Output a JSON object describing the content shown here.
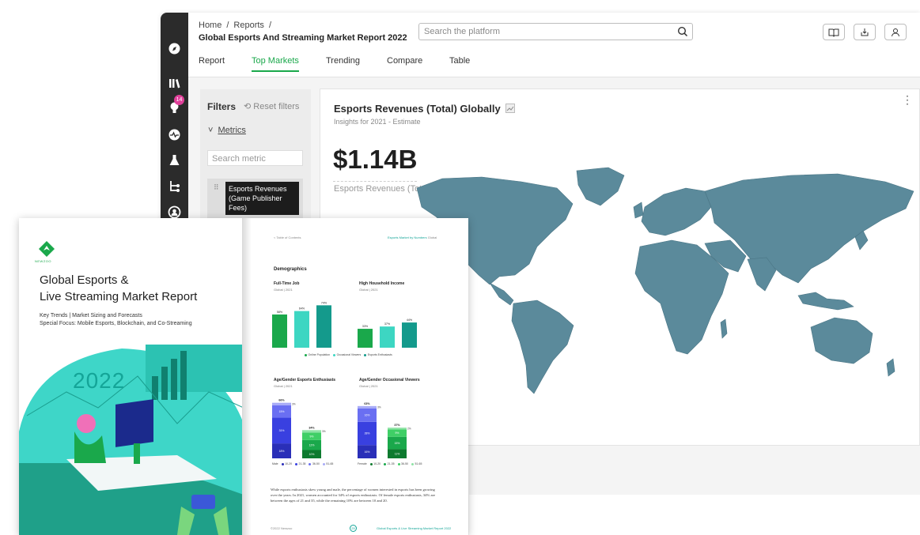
{
  "header": {
    "breadcrumb": [
      "Home",
      "/",
      "Reports",
      "/"
    ],
    "report_title": "Global Esports And Streaming Market Report 2022",
    "search_placeholder": "Search the platform"
  },
  "sidebar": {
    "badge_count": "14"
  },
  "tabs": [
    "Report",
    "Top Markets",
    "Trending",
    "Compare",
    "Table"
  ],
  "active_tab": "Top Markets",
  "filters": {
    "title": "Filters",
    "reset_label": "Reset filters",
    "metrics_label": "Metrics",
    "metric_search_placeholder": "Search metric",
    "selected_metric": "Esports Revenues (Game Publisher Fees)"
  },
  "card": {
    "title": "Esports Revenues (Total) Globally",
    "subtitle": "Insights for 2021 - Estimate",
    "value": "$1.14B",
    "value_label": "Esports Revenues (Total)",
    "map_color": "#5b8a9b"
  },
  "booklet": {
    "cover": {
      "brand": "NEWZOO",
      "title_line1": "Global Esports &",
      "title_line2": "Live Streaming Market Report",
      "sub_line1": "Key Trends | Market Sizing and Forecasts",
      "sub_line2": "Special Focus: Mobile Esports, Blockchain, and Co-Streaming",
      "year": "2022"
    },
    "page": {
      "toc_link": "< Table of Contents",
      "section_link": "Esports Market by Numbers",
      "section_link_suffix": "Global",
      "heading": "Demographics",
      "chart1_title": "Full-Time Job",
      "chart1_sub": "Global | 2021",
      "chart2_title": "High Household Income",
      "chart2_sub": "Global | 2021",
      "chart3_title": "Age/Gender Esports Enthusiasts",
      "chart3_sub": "Global | 2021",
      "chart4_title": "Age/Gender Occasional Viewers",
      "chart4_sub": "Global | 2021",
      "legend_top": [
        "Online Population",
        "Occasional Viewers",
        "Esports Enthusiasts"
      ],
      "legend_male": [
        "Male",
        "10-20",
        "21-35",
        "36-50",
        "51-65"
      ],
      "legend_female": [
        "Female",
        "10-20",
        "21-35",
        "36-50",
        "51-65"
      ],
      "body": "While esports enthusiasts skew young and male, the percentage of women interested in esports has been growing over the years. In 2021, women accounted for 34% of esports enthusiasts. Of female esports enthusiasts, 34% are between the ages of 21 and 35, while the remaining 10% are between 10 and 20.",
      "footer_left": "©2022 Newzoo",
      "footer_page": "25",
      "footer_right": "Global Esports & Live Streaming Market Report 2022"
    }
  },
  "chart_data": [
    {
      "type": "bar",
      "title": "Full-Time Job",
      "subtitle": "Global | 2021",
      "categories": [
        "Online Population",
        "Occasional Viewers",
        "Esports Enthusiasts"
      ],
      "values": [
        58,
        64,
        74
      ],
      "value_labels": [
        "58%",
        "64%",
        "74%"
      ],
      "colors": [
        "#1aa84b",
        "#3dd6c2",
        "#149a8c"
      ]
    },
    {
      "type": "bar",
      "title": "High Household Income",
      "subtitle": "Global | 2021",
      "categories": [
        "Online Population",
        "Occasional Viewers",
        "Esports Enthusiasts"
      ],
      "values": [
        33,
        37,
        44
      ],
      "value_labels": [
        "33%",
        "37%",
        "44%"
      ],
      "colors": [
        "#1aa84b",
        "#3dd6c2",
        "#149a8c"
      ]
    },
    {
      "type": "bar",
      "title": "Age/Gender Esports Enthusiasts",
      "subtitle": "Global | 2021",
      "categories": [
        "Male",
        "Female"
      ],
      "totals": [
        "66%",
        "34%"
      ],
      "series": [
        {
          "name": "10-20",
          "values": [
            18,
            10
          ],
          "labels": [
            "18%",
            "10%"
          ]
        },
        {
          "name": "21-35",
          "values": [
            31,
            12
          ],
          "labels": [
            "31%",
            "12%"
          ]
        },
        {
          "name": "36-50",
          "values": [
            15,
            9
          ],
          "labels": [
            "15%",
            "9%"
          ]
        },
        {
          "name": "51-65",
          "values": [
            3,
            3
          ],
          "labels": [
            "3%",
            "3%"
          ]
        }
      ],
      "colors_male": [
        "#2a2fb8",
        "#3940e0",
        "#6a6ff2",
        "#a8abf7"
      ],
      "colors_female": [
        "#0e7a2f",
        "#1aa84b",
        "#3fcf66",
        "#8fe3a6"
      ]
    },
    {
      "type": "bar",
      "title": "Age/Gender Occasional Viewers",
      "subtitle": "Global | 2021",
      "categories": [
        "Male",
        "Female"
      ],
      "totals": [
        "63%",
        "37%"
      ],
      "series": [
        {
          "name": "10-20",
          "values": [
            16,
            11
          ],
          "labels": [
            "16%",
            "11%"
          ]
        },
        {
          "name": "21-35",
          "values": [
            28,
            15
          ],
          "labels": [
            "28%",
            "15%"
          ]
        },
        {
          "name": "36-50",
          "values": [
            16,
            9
          ],
          "labels": [
            "16%",
            "9%"
          ]
        },
        {
          "name": "51-65",
          "values": [
            3,
            2
          ],
          "labels": [
            "3%",
            "2%"
          ]
        }
      ],
      "colors_male": [
        "#2a2fb8",
        "#3940e0",
        "#6a6ff2",
        "#a8abf7"
      ],
      "colors_female": [
        "#0e7a2f",
        "#1aa84b",
        "#3fcf66",
        "#8fe3a6"
      ]
    }
  ]
}
